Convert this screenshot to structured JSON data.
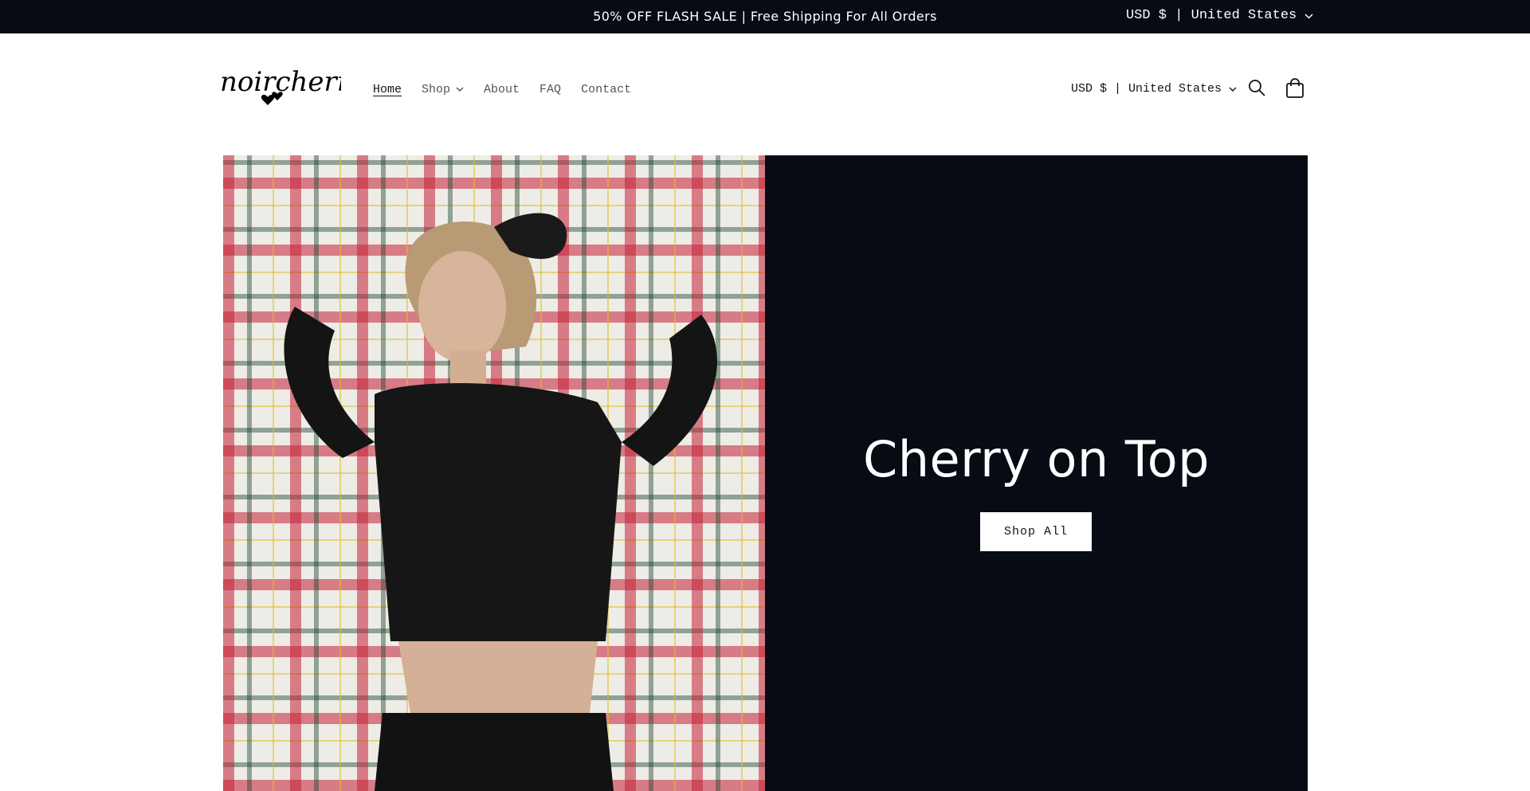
{
  "announcement": {
    "text": "50% OFF FLASH SALE | Free Shipping For All Orders",
    "locale": "USD $ | United States"
  },
  "header": {
    "logo_alt": "noircherry",
    "nav": [
      {
        "label": "Home",
        "active": true
      },
      {
        "label": "Shop",
        "has_dropdown": true
      },
      {
        "label": "About"
      },
      {
        "label": "FAQ"
      },
      {
        "label": "Contact"
      }
    ],
    "locale": "USD $ | United States",
    "icons": [
      "search-icon",
      "cart-icon"
    ]
  },
  "hero": {
    "image_subject": "photo",
    "heading": "Cherry on Top",
    "button_label": "Shop All",
    "panel_color": "#060b14"
  }
}
